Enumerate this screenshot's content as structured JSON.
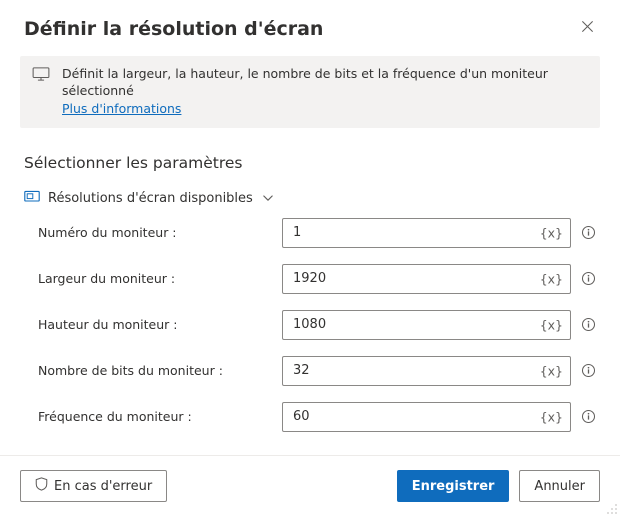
{
  "header": {
    "title": "Définir la résolution d'écran"
  },
  "info": {
    "text": "Définit la largeur, la hauteur, le nombre de bits et la fréquence d'un moniteur sélectionné",
    "link": "Plus d'informations"
  },
  "section": {
    "title": "Sélectionner les paramètres",
    "group_label": "Résolutions d'écran disponibles",
    "fields": {
      "monitor_number": {
        "label": "Numéro du moniteur :",
        "value": "1"
      },
      "monitor_width": {
        "label": "Largeur du moniteur :",
        "value": "1920"
      },
      "monitor_height": {
        "label": "Hauteur du moniteur :",
        "value": "1080"
      },
      "monitor_bits": {
        "label": "Nombre de bits du moniteur :",
        "value": "32"
      },
      "monitor_freq": {
        "label": "Fréquence du moniteur :",
        "value": "60"
      }
    },
    "variable_token": "{x}"
  },
  "footer": {
    "on_error": "En cas d'erreur",
    "save": "Enregistrer",
    "cancel": "Annuler"
  }
}
